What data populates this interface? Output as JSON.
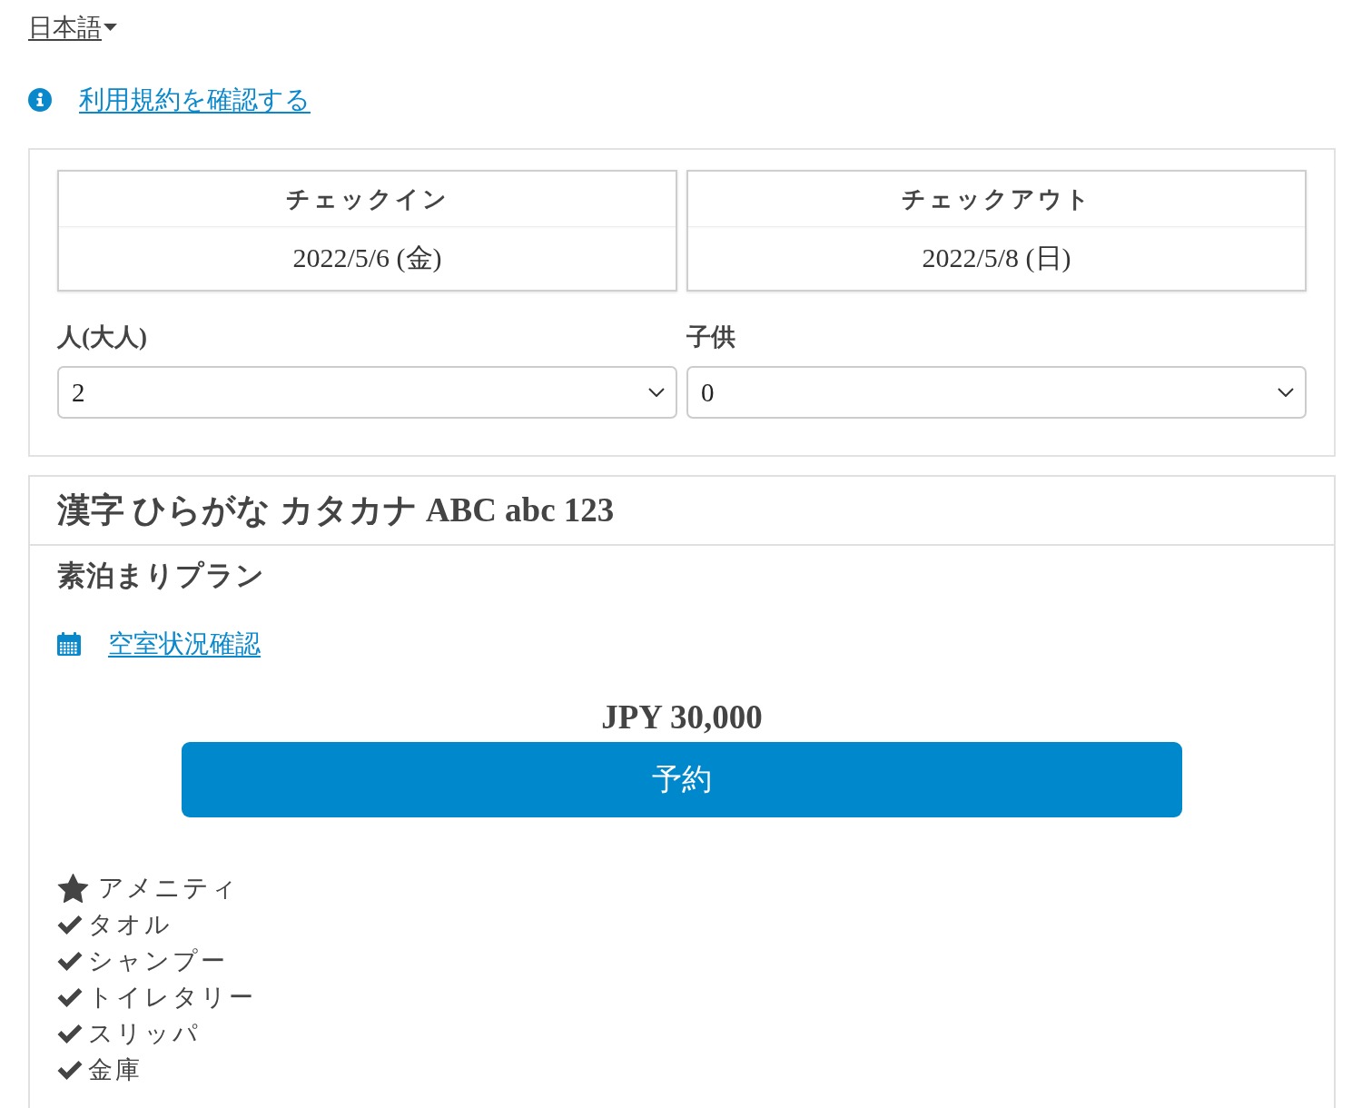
{
  "language_selector": {
    "label": "日本語"
  },
  "terms_link": {
    "label": "利用規約を確認する"
  },
  "search": {
    "dates": [
      {
        "label": "チェックイン",
        "value": "2022/5/6 (金)"
      },
      {
        "label": "チェックアウト",
        "value": "2022/5/8 (日)"
      }
    ],
    "guests": [
      {
        "label": "人(大人)",
        "value": "2"
      },
      {
        "label": "子供",
        "value": "0"
      }
    ]
  },
  "plan": {
    "title": "漢字 ひらがな カタカナ ABC abc 123",
    "name": "素泊まりプラン",
    "availability_link": "空室状況確認",
    "price": "JPY 30,000",
    "reserve_button": "予約",
    "amenities": {
      "heading": "アメニティ",
      "items": [
        "タオル",
        "シャンプー",
        "トイレタリー",
        "スリッパ",
        "金庫"
      ]
    }
  }
}
